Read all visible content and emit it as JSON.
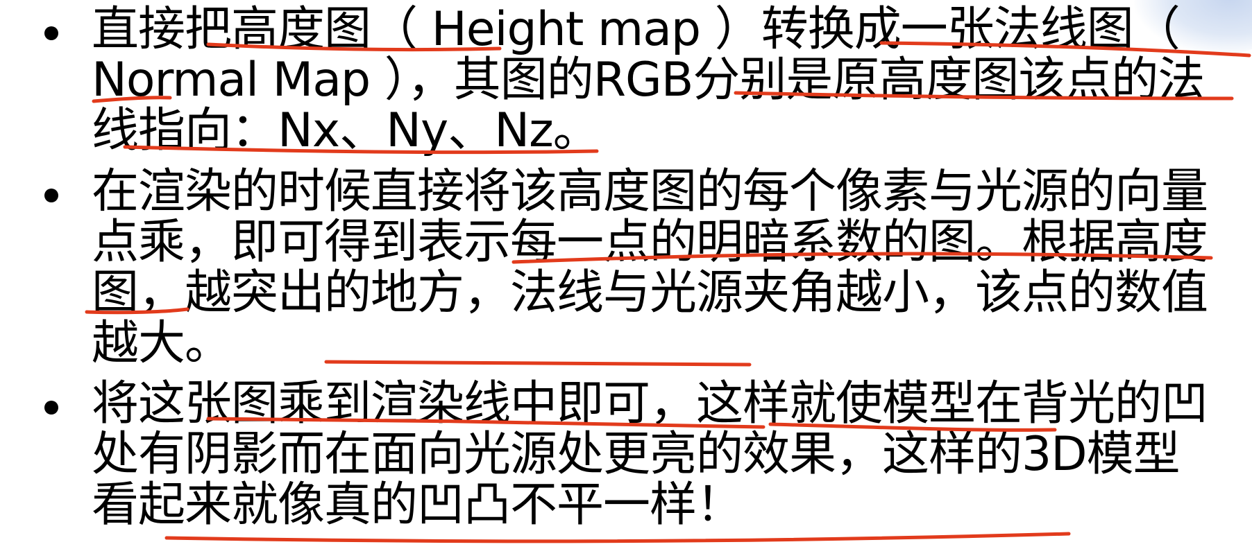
{
  "bullets": [
    {
      "text": "直接把高度图（ Height map ）转换成一张法线图（ Normal Map ），其图的RGB分别是原高度图该点的法线指向：Nx、Ny、Nz。"
    },
    {
      "text": "在渲染的时候直接将该高度图的每个像素与光源的向量点乘，即可得到表示每一点的明暗系数的图。根据高度图，越突出的地方，法线与光源夹角越小，该点的数值越大。"
    },
    {
      "text": "将这张图乘到渲染线中即可，这样就使模型在背光的凹处有阴影而在面向光源处更亮的效果，这样的3D模型看起来就像真的凹凸不平一样！"
    }
  ],
  "colors": {
    "text": "#000000",
    "annotation_ink": "#e23b1c",
    "background": "#ffffff"
  }
}
